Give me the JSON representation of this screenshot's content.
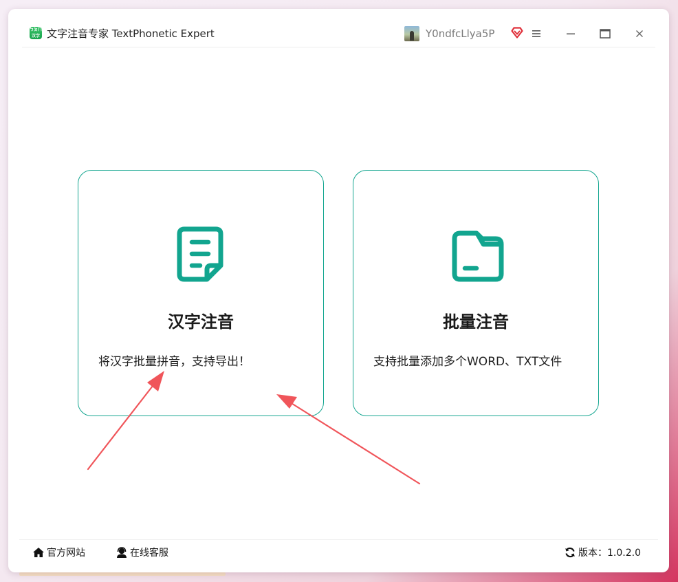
{
  "window": {
    "logo_text_top": "ㄅㄆㄇ",
    "logo_text_bottom": "汉字",
    "title": "文字注音专家 TextPhonetic Expert"
  },
  "user": {
    "name": "Y0ndfcLlya5P"
  },
  "cards": [
    {
      "title": "汉字注音",
      "description": "将汉字批量拼音，支持导出！",
      "icon": "document-icon"
    },
    {
      "title": "批量注音",
      "description": "支持批量添加多个WORD、TXT文件",
      "icon": "folder-icon"
    }
  ],
  "footer": {
    "site_label": "官方网站",
    "service_label": "在线客服",
    "version_label": "版本：1.0.2.0"
  },
  "colors": {
    "accent": "#12a58f",
    "arrow": "#f0555a",
    "vip": "#e0323c"
  }
}
